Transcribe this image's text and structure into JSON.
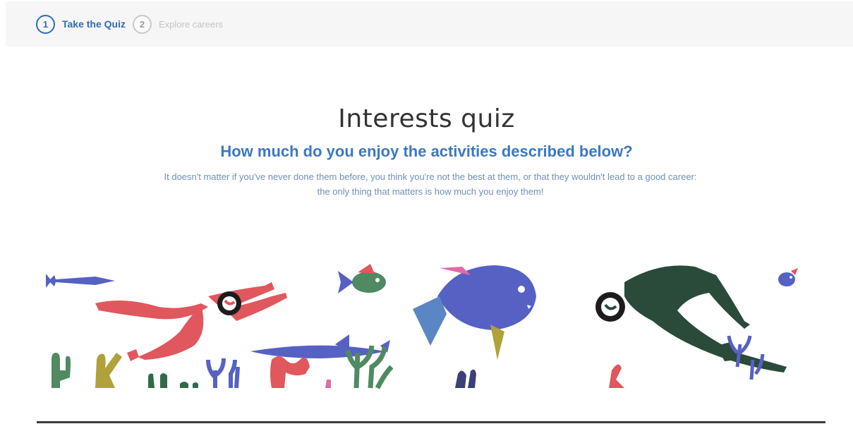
{
  "stepper": {
    "steps": [
      {
        "number": "1",
        "label": "Take the Quiz",
        "state": "active"
      },
      {
        "number": "2",
        "label": "Explore careers",
        "state": "inactive"
      }
    ]
  },
  "quiz": {
    "title": "Interests quiz",
    "question": "How much do you enjoy the activities described below?",
    "description": "It doesn't matter if you've never done them before, you think you're not the best at them, or that they wouldn't lead to a good career: the only thing that matters is how much you enjoy them!"
  },
  "colors": {
    "accent": "#2f6cb5",
    "subtitle": "#3b78c2",
    "description": "#6f8fba"
  },
  "illustration": {
    "name": "underwater-scene",
    "elements": [
      "barracuda",
      "red-diver",
      "green-fish",
      "big-blue-fish",
      "small-purple-fish",
      "green-frog-diver",
      "seaweed"
    ]
  }
}
